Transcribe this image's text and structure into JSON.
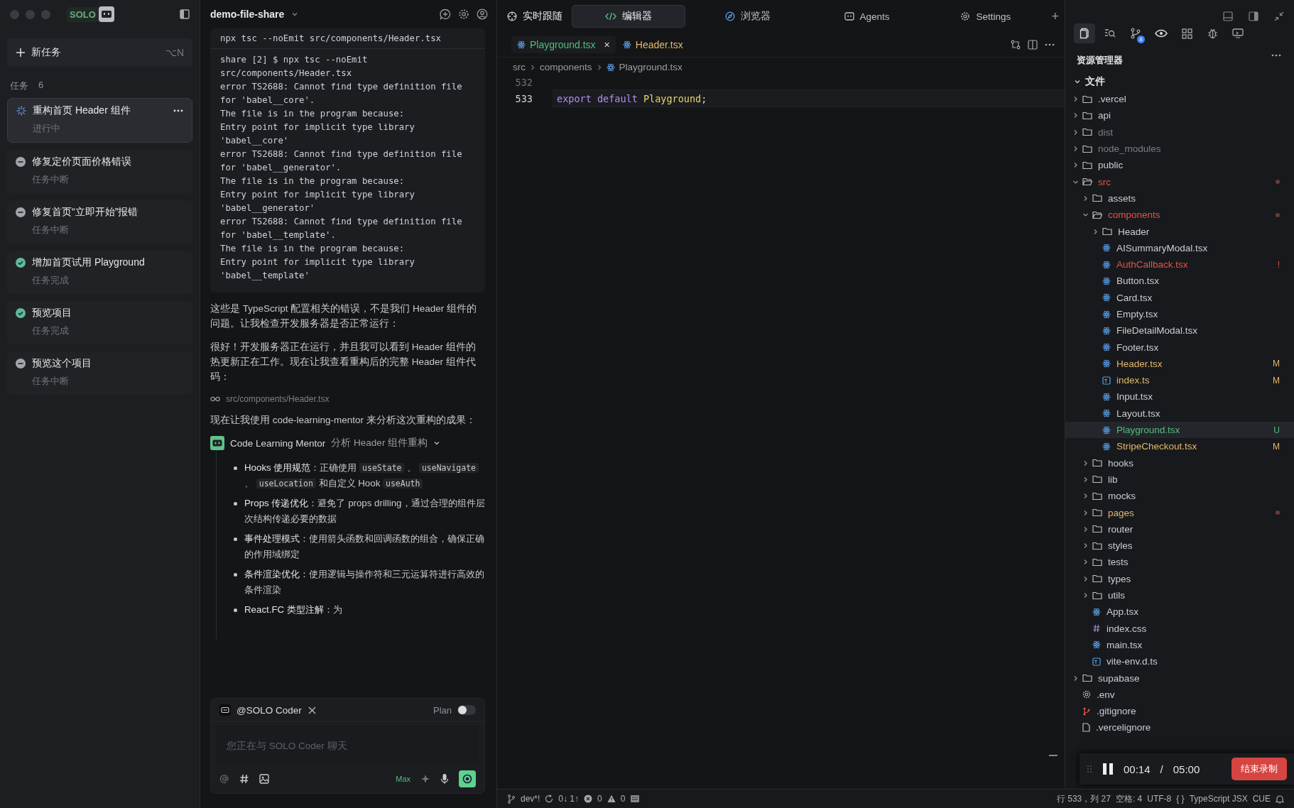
{
  "sidebar": {
    "logo": "SOLO",
    "new_task": {
      "label": "新任务",
      "shortcut": "⌥N"
    },
    "tasks_label": "任务",
    "tasks_count": "6",
    "tasks": [
      {
        "title": "重构首页 Header 组件",
        "status": "进行中",
        "kind": "running",
        "selected": true
      },
      {
        "title": "修复定价页面价格错误",
        "status": "任务中断",
        "kind": "interrupted",
        "selected": false
      },
      {
        "title": "修复首页“立即开始”报错",
        "status": "任务中断",
        "kind": "interrupted",
        "selected": false
      },
      {
        "title": "增加首页试用 Playground",
        "status": "任务完成",
        "kind": "done",
        "selected": false
      },
      {
        "title": "预览项目",
        "status": "任务完成",
        "kind": "done",
        "selected": false
      },
      {
        "title": "预览这个项目",
        "status": "任务中断",
        "kind": "interrupted",
        "selected": false
      }
    ]
  },
  "chat": {
    "project": "demo-file-share",
    "command": "npx tsc --noEmit src/components/Header.tsx",
    "output": [
      "share [2] $ npx tsc --noEmit",
      "src/components/Header.tsx",
      "error TS2688: Cannot find type definition file",
      "for 'babel__core'.",
      "The file is in the program because:",
      "Entry point for implicit type library",
      "'babel__core'",
      "error TS2688: Cannot find type definition file",
      "for 'babel__generator'.",
      "The file is in the program because:",
      "Entry point for implicit type library",
      "'babel__generator'",
      "error TS2688: Cannot find type definition file",
      "for 'babel__template'.",
      "The file is in the program because:",
      "Entry point for implicit type library",
      "'babel__template'"
    ],
    "paragraphs": [
      "这些是 TypeScript 配置相关的错误，不是我们 Header 组件的问题。让我检查开发服务器是否正常运行：",
      "很好！开发服务器正在运行，并且我可以看到 Header 组件的热更新正在工作。现在让我查看重构后的完整 Header 组件代码："
    ],
    "file_ref": "src/components/Header.tsx",
    "paragraph_2": "现在让我使用 code-learning-mentor 来分析这次重构的成果：",
    "agent": {
      "name": "Code Learning Mentor",
      "task": "分析 Header 组件重构"
    },
    "bullets": [
      [
        {
          "text": "Hooks 使用规范",
          "kind": "bold"
        },
        {
          "text": "：正确使用 ",
          "kind": "text"
        },
        {
          "text": "useState",
          "kind": "code"
        },
        {
          "text": " 、 ",
          "kind": "text"
        },
        {
          "text": "useNavigate",
          "kind": "code"
        },
        {
          "text": " 、 ",
          "kind": "text"
        },
        {
          "text": "useLocation",
          "kind": "code"
        },
        {
          "text": " 和自定义 Hook ",
          "kind": "text"
        },
        {
          "text": "useAuth",
          "kind": "code"
        }
      ],
      [
        {
          "text": "Props 传递优化",
          "kind": "bold"
        },
        {
          "text": "：避免了 props drilling，通过合理的组件层次结构传递必要的数据",
          "kind": "text"
        }
      ],
      [
        {
          "text": "事件处理模式",
          "kind": "bold"
        },
        {
          "text": "：使用箭头函数和回调函数的组合，确保正确的作用域绑定",
          "kind": "text"
        }
      ],
      [
        {
          "text": "条件渲染优化",
          "kind": "bold"
        },
        {
          "text": "：使用逻辑与操作符和三元运算符进行高效的条件渲染",
          "kind": "text"
        }
      ],
      [
        {
          "text": "React.FC 类型注解",
          "kind": "bold"
        },
        {
          "text": "：为",
          "kind": "text"
        }
      ]
    ],
    "input": {
      "agent": "@SOLO Coder",
      "plan_label": "Plan",
      "plan_on": false,
      "placeholder": "您正在与 SOLO Coder 聊天",
      "mode": "Max"
    }
  },
  "top_tabs": [
    {
      "label": "实时跟随",
      "kind": "follow",
      "selected": false
    },
    {
      "label": "编辑器",
      "kind": "editor",
      "selected": true
    },
    {
      "label": "浏览器",
      "kind": "browser",
      "selected": false
    },
    {
      "label": "Agents",
      "kind": "agents",
      "selected": false
    },
    {
      "label": "Settings",
      "kind": "settings",
      "selected": false
    }
  ],
  "add_tab": "+",
  "editor": {
    "tabs": [
      {
        "label": "Playground.tsx",
        "color": "#4fbf7f",
        "selected": true,
        "close": "×"
      },
      {
        "label": "Header.tsx",
        "color": "#e3b96a",
        "selected": false
      }
    ],
    "breadcrumb": [
      "src",
      "components",
      "Playground.tsx"
    ],
    "lines": [
      {
        "number": "532",
        "current": false
      },
      {
        "number": "533",
        "current": true,
        "tokens": [
          {
            "text": "export ",
            "kind": "keyword"
          },
          {
            "text": "default ",
            "kind": "keyword"
          },
          {
            "text": "Playground",
            "kind": "ident"
          },
          {
            "text": ";",
            "kind": "plain"
          }
        ]
      }
    ]
  },
  "explorer": {
    "title": "资源管理器",
    "git_badge": "8",
    "section": "文件",
    "tree": [
      {
        "name": ".vercel",
        "kind": "folder",
        "expanded": false,
        "color": "#c9ccd3"
      },
      {
        "name": "api",
        "kind": "folder",
        "expanded": false,
        "color": "#c9ccd3"
      },
      {
        "name": "dist",
        "kind": "folder",
        "expanded": false,
        "color": "#7a7e87"
      },
      {
        "name": "node_modules",
        "kind": "folder",
        "expanded": false,
        "color": "#7a7e87"
      },
      {
        "name": "public",
        "kind": "folder",
        "expanded": false,
        "color": "#c9ccd3"
      },
      {
        "name": "src",
        "kind": "folder",
        "expanded": true,
        "color": "#e5534b",
        "dot": true,
        "children": [
          {
            "name": "assets",
            "kind": "folder",
            "expanded": false,
            "color": "#c9ccd3"
          },
          {
            "name": "components",
            "kind": "folder",
            "expanded": true,
            "color": "#e5534b",
            "dot": true,
            "children": [
              {
                "name": "Header",
                "kind": "folder",
                "expanded": false,
                "color": "#c9ccd3"
              },
              {
                "name": "AISummaryModal.tsx",
                "kind": "react",
                "color": "#c9ccd3"
              },
              {
                "name": "AuthCallback.tsx",
                "kind": "react",
                "color": "#e5534b",
                "badge": "!"
              },
              {
                "name": "Button.tsx",
                "kind": "react",
                "color": "#c9ccd3"
              },
              {
                "name": "Card.tsx",
                "kind": "react",
                "color": "#c9ccd3"
              },
              {
                "name": "Empty.tsx",
                "kind": "react",
                "color": "#c9ccd3"
              },
              {
                "name": "FileDetailModal.tsx",
                "kind": "react",
                "color": "#c9ccd3"
              },
              {
                "name": "Footer.tsx",
                "kind": "react",
                "color": "#c9ccd3"
              },
              {
                "name": "Header.tsx",
                "kind": "react",
                "color": "#e3b96a",
                "badge": "M"
              },
              {
                "name": "index.ts",
                "kind": "ts",
                "color": "#e3b96a",
                "badge": "M"
              },
              {
                "name": "Input.tsx",
                "kind": "react",
                "color": "#c9ccd3"
              },
              {
                "name": "Layout.tsx",
                "kind": "react",
                "color": "#c9ccd3"
              },
              {
                "name": "Playground.tsx",
                "kind": "react",
                "color": "#4fbf7f",
                "badge": "U",
                "selected": true
              },
              {
                "name": "StripeCheckout.tsx",
                "kind": "react",
                "color": "#e3b96a",
                "badge": "M"
              }
            ]
          },
          {
            "name": "hooks",
            "kind": "folder",
            "expanded": false,
            "color": "#c9ccd3"
          },
          {
            "name": "lib",
            "kind": "folder",
            "expanded": false,
            "color": "#c9ccd3"
          },
          {
            "name": "mocks",
            "kind": "folder",
            "expanded": false,
            "color": "#c9ccd3"
          },
          {
            "name": "pages",
            "kind": "folder",
            "expanded": false,
            "color": "#e3b96a",
            "dot": true
          },
          {
            "name": "router",
            "kind": "folder",
            "expanded": false,
            "color": "#c9ccd3"
          },
          {
            "name": "styles",
            "kind": "folder",
            "expanded": false,
            "color": "#c9ccd3"
          },
          {
            "name": "tests",
            "kind": "folder",
            "expanded": false,
            "color": "#c9ccd3"
          },
          {
            "name": "types",
            "kind": "folder",
            "expanded": false,
            "color": "#c9ccd3"
          },
          {
            "name": "utils",
            "kind": "folder",
            "expanded": false,
            "color": "#c9ccd3"
          },
          {
            "name": "App.tsx",
            "kind": "react",
            "color": "#c9ccd3"
          },
          {
            "name": "index.css",
            "kind": "css",
            "color": "#c9ccd3"
          },
          {
            "name": "main.tsx",
            "kind": "react",
            "color": "#c9ccd3"
          },
          {
            "name": "vite-env.d.ts",
            "kind": "ts",
            "color": "#c9ccd3"
          }
        ]
      },
      {
        "name": "supabase",
        "kind": "folder",
        "expanded": false,
        "color": "#c9ccd3"
      },
      {
        "name": ".env",
        "kind": "config",
        "color": "#c9ccd3"
      },
      {
        "name": ".gitignore",
        "kind": "git",
        "color": "#c9ccd3"
      },
      {
        "name": ".vercelignore",
        "kind": "doc",
        "color": "#c9ccd3"
      }
    ]
  },
  "recording": {
    "elapsed": "00:14",
    "separator": "/",
    "limit": "05:00",
    "stop": "结束录制"
  },
  "status_bar": {
    "branch": "dev*!",
    "sync": "0↓ 1↑",
    "errors": "0",
    "warnings": "0",
    "position": "行 533，列 27",
    "indent": "空格: 4",
    "encoding": "UTF-8",
    "braces": "{ }",
    "language": "TypeScript JSX",
    "cue": "CUE"
  }
}
